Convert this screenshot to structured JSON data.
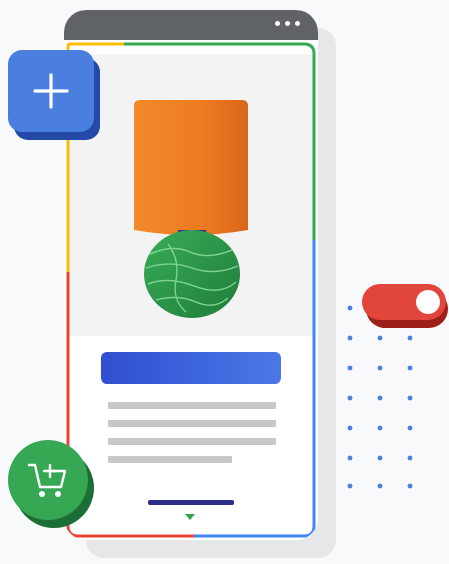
{
  "illustration": {
    "phone_menu_icon": "more-horizontal-icon",
    "add_button_icon": "plus-icon",
    "cart_button_icon": "add-to-cart-icon",
    "toggle_state": "on",
    "product": "lamp"
  },
  "colors": {
    "phone_topbar": "#5f6368",
    "add_button": "#4a7fe0",
    "cart_button": "#36a853",
    "toggle": "#e2453c",
    "cta_bar": "#3b63dc",
    "lamp_shade": "#ee7a22",
    "lamp_base": "#2e9b4b",
    "dot_grid": "#4a7fe0",
    "frame_red": "#ea4335",
    "frame_yellow": "#fbbc04",
    "frame_green": "#34a853",
    "frame_blue": "#4285f4"
  }
}
